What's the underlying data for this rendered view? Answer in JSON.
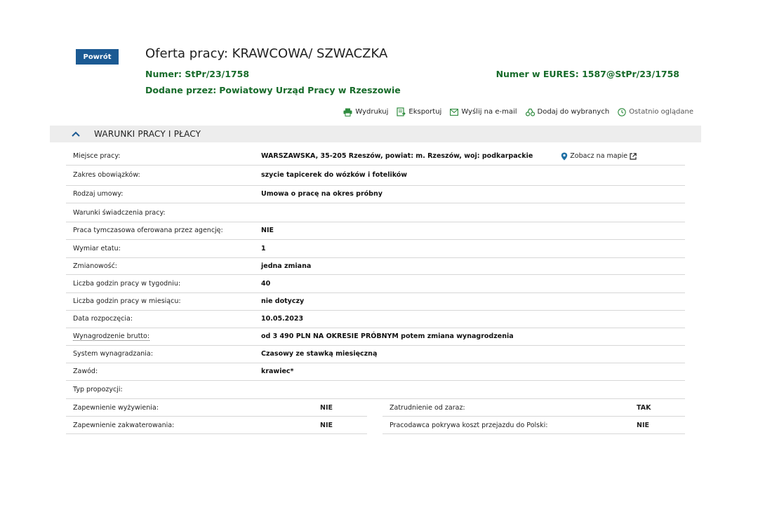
{
  "header": {
    "back_label": "Powrót",
    "title": "Oferta pracy: KRAWCOWA/ SZWACZKA",
    "number_label": "Numer:",
    "number_value": "StPr/23/1758",
    "eures_label": "Numer w EURES:",
    "eures_value": "1587@StPr/23/1758",
    "added_label": "Dodane przez:",
    "added_value": "Powiatowy Urząd Pracy w Rzeszowie"
  },
  "toolbar": {
    "print": "Wydrukuj",
    "export": "Eksportuj",
    "email": "Wyślij na e-mail",
    "favorite": "Dodaj do wybranych",
    "recent": "Ostatnio oglądane"
  },
  "colors": {
    "primary": "#1b5a93",
    "green": "#176b2a",
    "section_bg": "#ededed",
    "icon_green": "#2e8b3e",
    "map_pin": "#1d6fa5"
  },
  "section": {
    "title": "WARUNKI PRACY I PŁACY",
    "rows": [
      {
        "label": "Miejsce pracy:",
        "value": "WARSZAWSKA, 35-205 Rzeszów, powiat: m. Rzeszów, woj: podkarpackie"
      },
      {
        "label": "Zakres obowiązków:",
        "value": "szycie tapicerek do wózków i fotelików"
      },
      {
        "label": "Rodzaj umowy:",
        "value": "Umowa o pracę na okres próbny"
      },
      {
        "label": "Warunki świadczenia pracy:",
        "value": ""
      },
      {
        "label": "Praca tymczasowa oferowana przez agencję:",
        "value": "NIE"
      },
      {
        "label": "Wymiar etatu:",
        "value": "1"
      },
      {
        "label": "Zmianowość:",
        "value": "jedna zmiana"
      },
      {
        "label": "Liczba godzin pracy w tygodniu:",
        "value": "40"
      },
      {
        "label": "Liczba godzin pracy w miesiącu:",
        "value": "nie dotyczy"
      },
      {
        "label": "Data rozpoczęcia:",
        "value": "10.05.2023"
      },
      {
        "label": "Wynagrodzenie brutto:",
        "value": "od 3 490 PLN NA OKRESIE PRÓBNYM potem zmiana wynagrodzenia"
      },
      {
        "label": "System wynagradzania:",
        "value": "Czasowy ze stawką miesięczną"
      },
      {
        "label": "Zawód:",
        "value": "krawiec*"
      },
      {
        "label": "Typ propozycji:",
        "value": ""
      }
    ],
    "map_link": "Zobacz na mapie",
    "split_rows": [
      {
        "left_label": "Zapewnienie wyżywienia:",
        "left_value": "NIE",
        "right_label": "Zatrudnienie od zaraz:",
        "right_value": "TAK"
      },
      {
        "left_label": "Zapewnienie zakwaterowania:",
        "left_value": "NIE",
        "right_label": "Pracodawca pokrywa koszt przejazdu do Polski:",
        "right_value": "NIE"
      }
    ]
  }
}
